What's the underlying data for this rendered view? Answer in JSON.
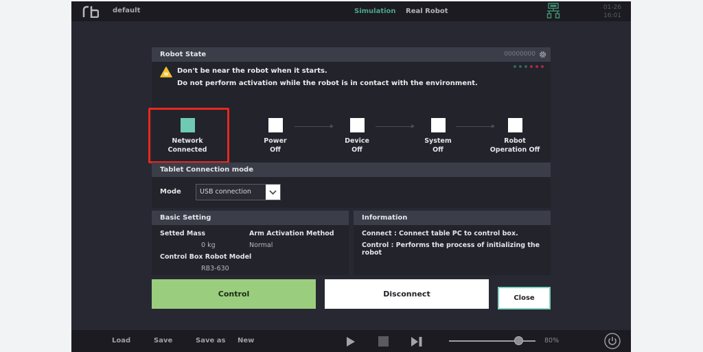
{
  "topbar": {
    "logo": "rb-logo",
    "project_name": "default",
    "modes": [
      {
        "label": "Simulation",
        "active": true
      },
      {
        "label": "Real Robot",
        "active": false
      }
    ],
    "network_icon": "usb-network-icon",
    "date": "01-26",
    "time": "16:01"
  },
  "robot_state": {
    "title": "Robot State",
    "serial": "00000000",
    "settings_icon": "gear-icon",
    "leds": [
      "#2f6a55",
      "#2f6a55",
      "#2f6a55",
      "#a52c48",
      "#a52c48",
      "#a52c48"
    ],
    "warning_line1": "Don't be near the robot when it starts.",
    "warning_line2": "Do not perform activation while the robot is in contact with the environment.",
    "steps": [
      {
        "line1": "Network",
        "line2": "Connected",
        "color": "#6ecbb2",
        "highlighted": true
      },
      {
        "line1": "Power",
        "line2": "Off",
        "color": "#ffffff",
        "highlighted": false
      },
      {
        "line1": "Device",
        "line2": "Off",
        "color": "#ffffff",
        "highlighted": false
      },
      {
        "line1": "System",
        "line2": "Off",
        "color": "#ffffff",
        "highlighted": false
      },
      {
        "line1": "Robot",
        "line2": "Operation Off",
        "color": "#ffffff",
        "highlighted": false
      }
    ]
  },
  "tablet_connection": {
    "title": "Tablet Connection mode",
    "mode_label": "Mode",
    "mode_value": "USB connection"
  },
  "basic_setting": {
    "title": "Basic Setting",
    "setted_mass_label": "Setted Mass",
    "setted_mass_value": "0 kg",
    "arm_activation_label": "Arm Activation Method",
    "arm_activation_value": "Normal",
    "model_label": "Control Box Robot Model",
    "model_value": "RB3-630"
  },
  "information": {
    "title": "Information",
    "line1": "Connect : Connect table PC to control box.",
    "line2": "Control : Performs the process of initializing the robot"
  },
  "buttons": {
    "control": "Control",
    "disconnect": "Disconnect",
    "close": "Close"
  },
  "bottombar": {
    "load": "Load",
    "save": "Save",
    "save_as": "Save as",
    "new": "New",
    "speed_value": 0.8,
    "speed_label": "80%"
  }
}
